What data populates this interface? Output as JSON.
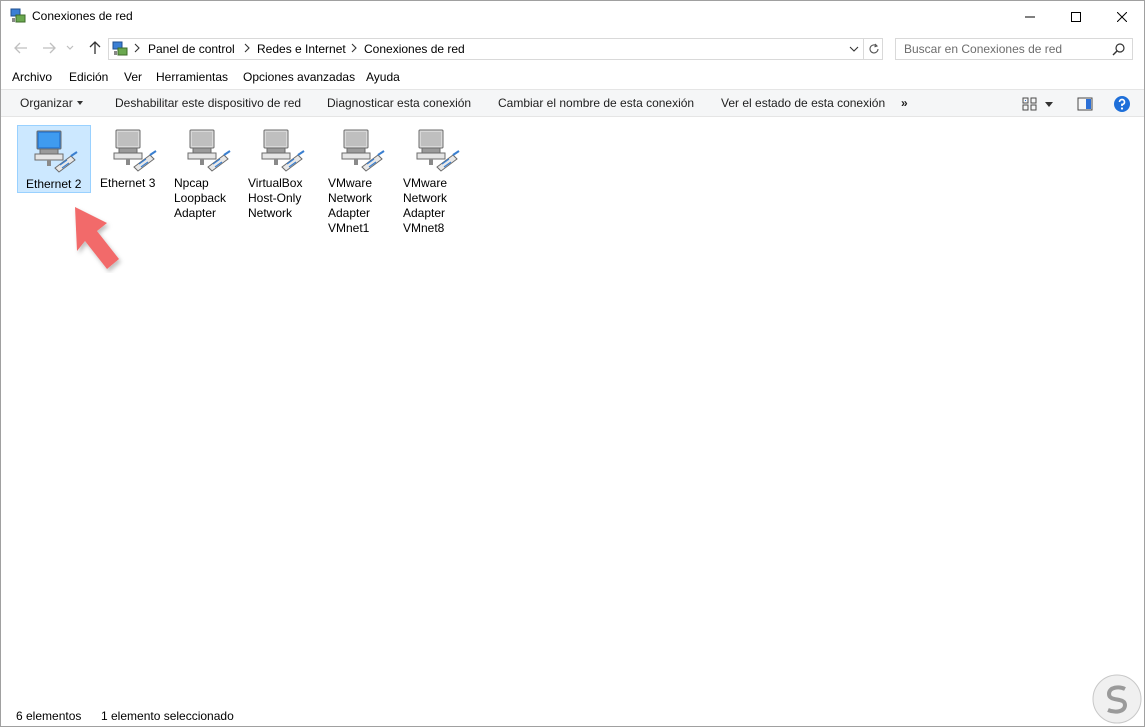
{
  "window": {
    "title": "Conexiones de red",
    "icon": "network-connections-icon"
  },
  "navigation": {
    "breadcrumbs": [
      "Panel de control",
      "Redes e Internet",
      "Conexiones de red"
    ],
    "search_placeholder": "Buscar en Conexiones de red"
  },
  "menubar": {
    "items": [
      "Archivo",
      "Edición",
      "Ver",
      "Herramientas",
      "Opciones avanzadas",
      "Ayuda"
    ]
  },
  "commandbar": {
    "organize": "Organizar",
    "disable": "Deshabilitar este dispositivo de red",
    "diagnose": "Diagnosticar esta conexión",
    "rename": "Cambiar el nombre de esta conexión",
    "status": "Ver el estado de esta conexión",
    "more": "»"
  },
  "connections": [
    {
      "label": [
        "Ethernet 2"
      ],
      "selected": true,
      "icon": "active-network-adapter-icon"
    },
    {
      "label": [
        "Ethernet 3"
      ],
      "selected": false,
      "icon": "network-adapter-icon"
    },
    {
      "label": [
        "Npcap",
        "Loopback",
        "Adapter"
      ],
      "selected": false,
      "icon": "network-adapter-icon"
    },
    {
      "label": [
        "VirtualBox",
        "Host-Only",
        "Network"
      ],
      "selected": false,
      "icon": "network-adapter-icon"
    },
    {
      "label": [
        "VMware",
        "Network",
        "Adapter",
        "VMnet1"
      ],
      "selected": false,
      "icon": "network-adapter-icon"
    },
    {
      "label": [
        "VMware",
        "Network",
        "Adapter",
        "VMnet8"
      ],
      "selected": false,
      "icon": "network-adapter-icon"
    }
  ],
  "statusbar": {
    "count": "6 elementos",
    "selection": "1 elemento seleccionado"
  },
  "colors": {
    "selection_bg": "#cce8ff",
    "selection_border": "#99d1ff",
    "annotation_arrow": "#f26b6b",
    "help_blue": "#1e6fd9"
  }
}
